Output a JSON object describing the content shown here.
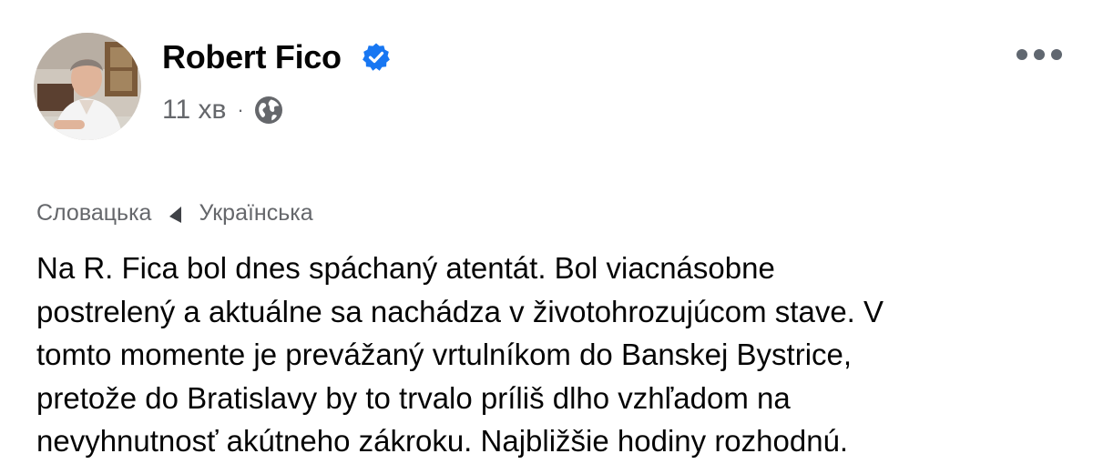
{
  "post": {
    "author": "Robert Fico",
    "time": "11 хв",
    "separator": "·",
    "icons": {
      "verified": "verified-badge-icon",
      "audience": "globe-icon",
      "more": "more-options-icon"
    },
    "colors": {
      "verified": "#1877f2",
      "secondary_text": "#65676b",
      "text": "#050505"
    }
  },
  "translation": {
    "source_language": "Словацька",
    "target_language": "Українська"
  },
  "content": {
    "lines": [
      "Na R. Fica bol dnes spáchaný atentát. Bol viacnásobne",
      "postrelený a aktuálne sa nachádza v životohrozujúcom stave. V",
      "tomto momente je prevážaný vrtulníkom do Banskej Bystrice,",
      "pretože do Bratislavy by to trvalo príliš dlho vzhľadom na",
      "nevyhnutnosť akútneho zákroku. Najbližšie hodiny rozhodnú."
    ]
  }
}
